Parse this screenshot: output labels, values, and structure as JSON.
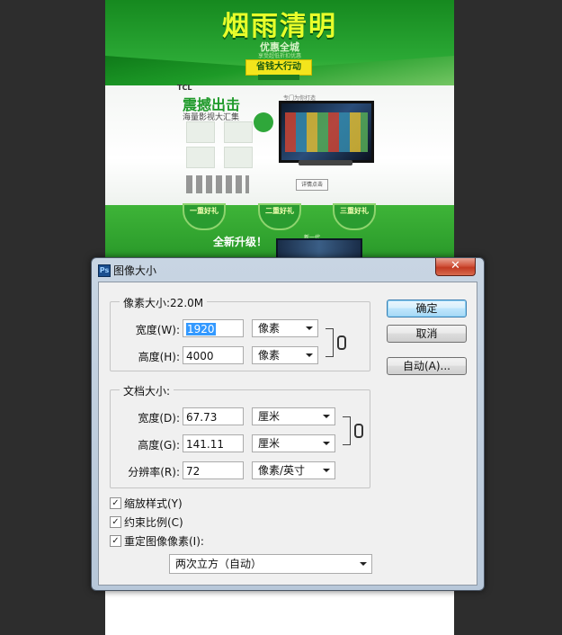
{
  "canvas": {
    "banner_title": "烟雨清明",
    "banner_subtitle": "优惠全城",
    "banner_small": "享受超低折扣优惠",
    "banner_button": "省钱大行动",
    "brand": "TCL",
    "promo_title": "震撼出击",
    "promo_subtitle": "海量影视大汇集",
    "tv_label": "专门为你打造",
    "detail_button": "详情点击",
    "gifts": [
      "一重好礼",
      "二重好礼",
      "三重好礼"
    ],
    "upgrade_text": "全新升级！",
    "new_gen_text": "新一代"
  },
  "dialog": {
    "title": "图像大小",
    "close_symbol": "✕",
    "pixel_dimensions": {
      "legend": "像素大小:22.0M",
      "width_label": "宽度(W):",
      "width_value": "1920",
      "width_unit": "像素",
      "height_label": "高度(H):",
      "height_value": "4000",
      "height_unit": "像素"
    },
    "document_size": {
      "legend": "文档大小:",
      "width_label": "宽度(D):",
      "width_value": "67.73",
      "width_unit": "厘米",
      "height_label": "高度(G):",
      "height_value": "141.11",
      "height_unit": "厘米",
      "resolution_label": "分辨率(R):",
      "resolution_value": "72",
      "resolution_unit": "像素/英寸"
    },
    "buttons": {
      "ok": "确定",
      "cancel": "取消",
      "auto": "自动(A)..."
    },
    "options": {
      "scale_styles": {
        "label": "缩放样式(Y)",
        "checked": true
      },
      "constrain_proportions": {
        "label": "约束比例(C)",
        "checked": true
      },
      "resample_image": {
        "label": "重定图像像素(I):",
        "checked": true
      },
      "resample_method": "两次立方（自动）"
    }
  }
}
